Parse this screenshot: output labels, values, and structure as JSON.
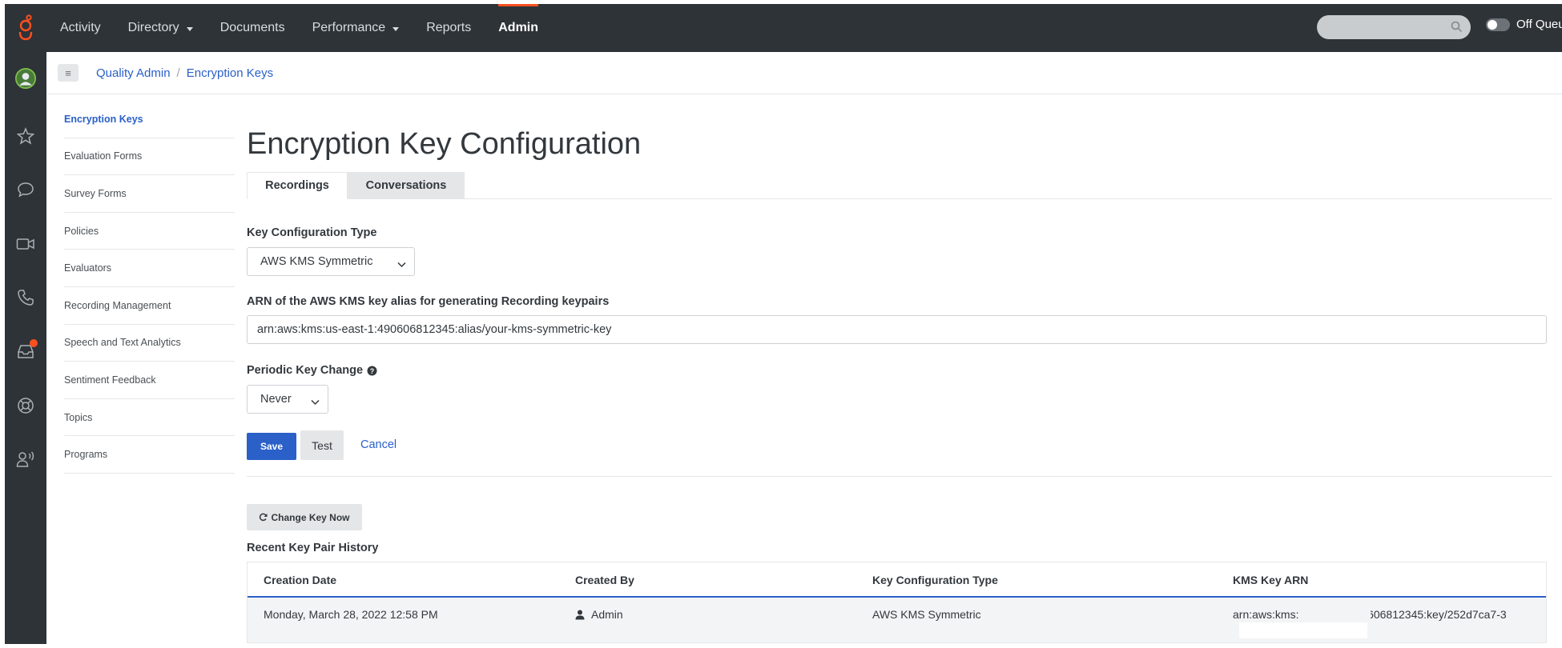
{
  "topbar": {
    "nav": [
      {
        "label": "Activity",
        "dropdown": false,
        "active": false
      },
      {
        "label": "Directory",
        "dropdown": true,
        "active": false
      },
      {
        "label": "Documents",
        "dropdown": false,
        "active": false
      },
      {
        "label": "Performance",
        "dropdown": true,
        "active": false
      },
      {
        "label": "Reports",
        "dropdown": false,
        "active": false
      },
      {
        "label": "Admin",
        "dropdown": false,
        "active": true
      }
    ],
    "search_placeholder": "",
    "queue_status": "Off Queue"
  },
  "rail_icons": [
    "avatar",
    "star-icon",
    "chat-icon",
    "video-icon",
    "phone-icon",
    "inbox-icon",
    "help-icon",
    "user-voice-icon"
  ],
  "breadcrumb": {
    "parent": "Quality Admin",
    "separator": "/",
    "current": "Encryption Keys"
  },
  "sidemenu": [
    {
      "label": "Encryption Keys",
      "active": true
    },
    {
      "label": "Evaluation Forms",
      "active": false
    },
    {
      "label": "Survey Forms",
      "active": false
    },
    {
      "label": "Policies",
      "active": false
    },
    {
      "label": "Evaluators",
      "active": false
    },
    {
      "label": "Recording Management",
      "active": false
    },
    {
      "label": "Speech and Text Analytics",
      "active": false
    },
    {
      "label": "Sentiment Feedback",
      "active": false
    },
    {
      "label": "Topics",
      "active": false
    },
    {
      "label": "Programs",
      "active": false
    }
  ],
  "main": {
    "title": "Encryption Key Configuration",
    "tabs": [
      {
        "label": "Recordings",
        "active": true
      },
      {
        "label": "Conversations",
        "active": false
      }
    ],
    "key_config_type_label": "Key Configuration Type",
    "key_config_type_value": "AWS KMS Symmetric",
    "arn_label": "ARN of the AWS KMS key alias for generating Recording keypairs",
    "arn_value": "arn:aws:kms:us-east-1:490606812345:alias/your-kms-symmetric-key",
    "periodic_label": "Periodic Key Change",
    "periodic_value": "Never",
    "save_label": "Save",
    "test_label": "Test",
    "cancel_label": "Cancel",
    "change_key_label": "Change Key Now",
    "history_title": "Recent Key Pair History"
  },
  "history_table": {
    "columns": [
      "Creation Date",
      "Created By",
      "Key Configuration Type",
      "KMS Key ARN"
    ],
    "rows": [
      {
        "creation_date": "Monday, March 28, 2022 12:58 PM",
        "created_by": "Admin",
        "key_config_type": "AWS KMS Symmetric",
        "kms_key_arn": "arn:aws:kms:us-east-1:490606812345:key/252d7ca7-3"
      }
    ]
  },
  "colors": {
    "topbar_bg": "#2e3338",
    "accent_blue": "#2a60c8",
    "brand_orange": "#ff4f1f"
  }
}
